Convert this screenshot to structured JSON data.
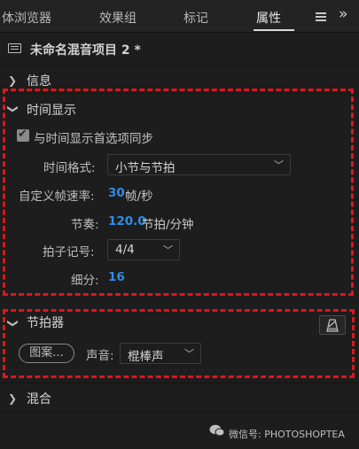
{
  "tabs": [
    {
      "label": "体浏览器"
    },
    {
      "label": "效果组"
    },
    {
      "label": "标记"
    },
    {
      "label": "属性",
      "active": true
    }
  ],
  "clip": {
    "title": "未命名混音项目 2 *"
  },
  "sections": {
    "info": {
      "title": "信息",
      "expanded": false
    },
    "time_display": {
      "title": "时间显示",
      "expanded": true,
      "sync_checkbox": {
        "label": "与时间显示首选项同步",
        "checked": true
      },
      "time_format": {
        "label": "时间格式:",
        "value": "小节与节拍"
      },
      "custom_fps": {
        "label": "自定义帧速率:",
        "value": "30",
        "unit": "帧/秒"
      },
      "tempo": {
        "label": "节奏:",
        "value": "120.0",
        "unit": "节拍/分钟"
      },
      "time_signature": {
        "label": "拍子记号:",
        "value": "4/4"
      },
      "subdivision": {
        "label": "细分:",
        "value": "16"
      }
    },
    "metronome": {
      "title": "节拍器",
      "expanded": true,
      "pattern_button": "图案...",
      "sound": {
        "label": "声音:",
        "value": "棍棒声"
      }
    },
    "mix": {
      "title": "混合",
      "expanded": false
    }
  },
  "watermark": {
    "text": "微信号: PHOTOSHOPTEA"
  },
  "colors": {
    "highlight_dash": "#e0141c",
    "value_blue": "#2d8ceb",
    "panel_bg": "#1d1d1d"
  },
  "icons": [
    "menu-icon",
    "more-icon",
    "clip-icon",
    "chevron-right-icon",
    "chevron-down-icon",
    "metronome-icon",
    "wechat-icon"
  ]
}
